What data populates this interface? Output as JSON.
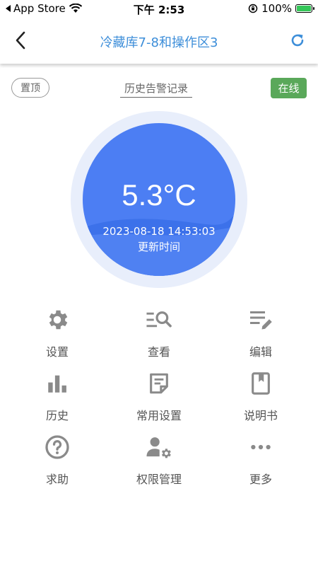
{
  "status_bar": {
    "back_app": "App Store",
    "time": "下午 2:53",
    "battery": "100%"
  },
  "nav": {
    "title": "冷藏库7-8和操作区3"
  },
  "toolbar": {
    "pin_label": "置顶",
    "history_label": "历史告警记录",
    "status_label": "在线"
  },
  "gauge": {
    "temperature": "5.3°C",
    "timestamp": "2023-08-18 14:53:03",
    "timestamp_label": "更新时间"
  },
  "menu": [
    {
      "label": "设置",
      "icon": "gear-icon"
    },
    {
      "label": "查看",
      "icon": "search-list-icon"
    },
    {
      "label": "编辑",
      "icon": "edit-list-icon"
    },
    {
      "label": "历史",
      "icon": "bar-chart-icon"
    },
    {
      "label": "常用设置",
      "icon": "note-icon"
    },
    {
      "label": "说明书",
      "icon": "book-icon"
    },
    {
      "label": "求助",
      "icon": "help-icon"
    },
    {
      "label": "权限管理",
      "icon": "user-settings-icon"
    },
    {
      "label": "更多",
      "icon": "more-icon"
    }
  ],
  "colors": {
    "accent": "#3d8ed9",
    "gauge_fill": "#4c7ef3",
    "gauge_ring": "#e8eefb",
    "online": "#5aa85a",
    "icon_gray": "#8a8a8a"
  }
}
